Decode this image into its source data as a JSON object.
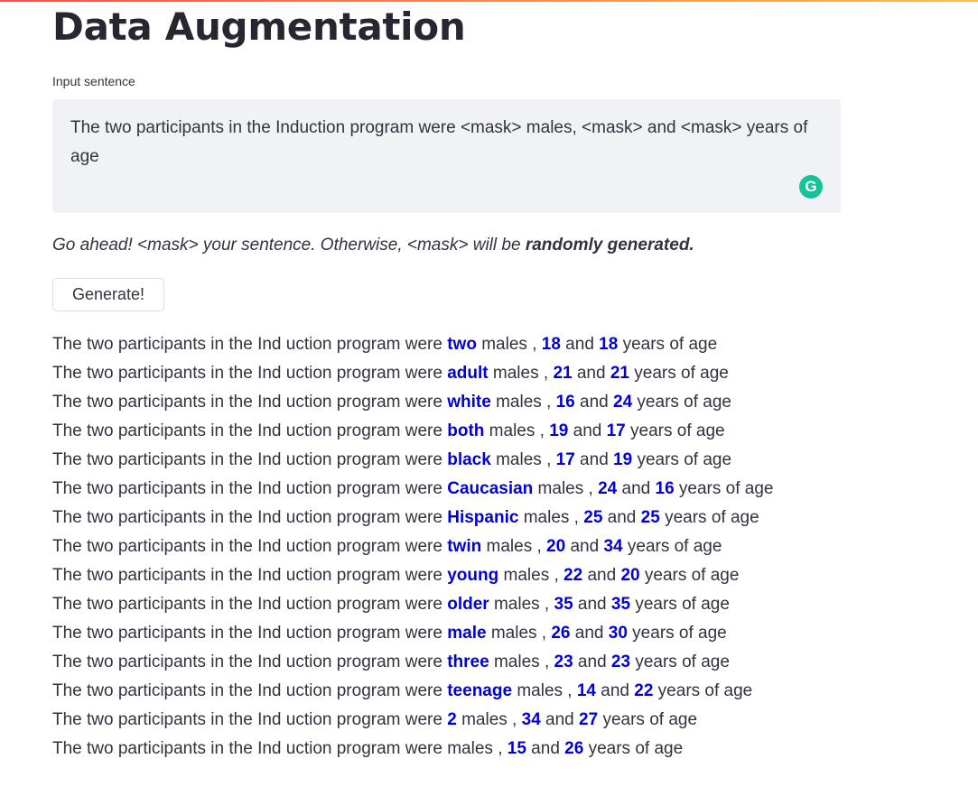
{
  "page": {
    "title": "Data Augmentation"
  },
  "input": {
    "label": "Input sentence",
    "value": "The two participants in the Induction program were <mask> males, <mask> and <mask> years of age",
    "grammarly_icon": "G"
  },
  "hint": {
    "prefix": "Go ahead! <mask> your sentence. Otherwise, <mask> will be ",
    "bold": "randomly generated."
  },
  "generate_button": {
    "label": "Generate!"
  },
  "results": {
    "prefix": "The two participants in the Ind uction program were ",
    "rows": [
      {
        "w1": "two",
        "w2": "18",
        "w3": "18"
      },
      {
        "w1": "adult",
        "w2": "21",
        "w3": "21"
      },
      {
        "w1": "white",
        "w2": "16",
        "w3": "24"
      },
      {
        "w1": "both",
        "w2": "19",
        "w3": "17"
      },
      {
        "w1": "black",
        "w2": "17",
        "w3": "19"
      },
      {
        "w1": "Caucasian",
        "w2": "24",
        "w3": "16"
      },
      {
        "w1": "Hispanic",
        "w2": "25",
        "w3": "25"
      },
      {
        "w1": "twin",
        "w2": "20",
        "w3": "34"
      },
      {
        "w1": "young",
        "w2": "22",
        "w3": "20"
      },
      {
        "w1": "older",
        "w2": "35",
        "w3": "35"
      },
      {
        "w1": "male",
        "w2": "26",
        "w3": "30"
      },
      {
        "w1": "three",
        "w2": "23",
        "w3": "23"
      },
      {
        "w1": "teenage",
        "w2": "14",
        "w3": "22"
      },
      {
        "w1": "2",
        "w2": "34",
        "w3": "27"
      },
      {
        "w1": "",
        "w2": "15",
        "w3": "26"
      }
    ]
  },
  "colors": {
    "highlight": "#0000dd",
    "text": "#31333f",
    "input_bg": "#f0f2f6",
    "grammarly": "#15c39a"
  }
}
